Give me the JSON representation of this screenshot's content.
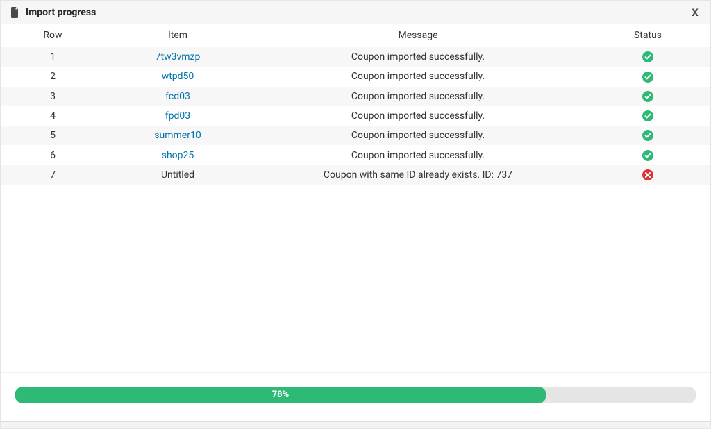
{
  "dialog": {
    "title": "Import progress",
    "close_label": "X"
  },
  "table": {
    "headers": {
      "row": "Row",
      "item": "Item",
      "message": "Message",
      "status": "Status"
    },
    "rows": [
      {
        "row": "1",
        "item": "7tw3vmzp",
        "item_is_link": true,
        "message": "Coupon imported successfully.",
        "status": "success"
      },
      {
        "row": "2",
        "item": "wtpd50",
        "item_is_link": true,
        "message": "Coupon imported successfully.",
        "status": "success"
      },
      {
        "row": "3",
        "item": "fcd03",
        "item_is_link": true,
        "message": "Coupon imported successfully.",
        "status": "success"
      },
      {
        "row": "4",
        "item": "fpd03",
        "item_is_link": true,
        "message": "Coupon imported successfully.",
        "status": "success"
      },
      {
        "row": "5",
        "item": "summer10",
        "item_is_link": true,
        "message": "Coupon imported successfully.",
        "status": "success"
      },
      {
        "row": "6",
        "item": "shop25",
        "item_is_link": true,
        "message": "Coupon imported successfully.",
        "status": "success"
      },
      {
        "row": "7",
        "item": "Untitled",
        "item_is_link": false,
        "message": "Coupon with same ID already exists. ID: 737",
        "status": "error"
      }
    ]
  },
  "progress": {
    "percent": 78,
    "label": "78%"
  },
  "colors": {
    "link": "#0073aa",
    "success": "#2fb977",
    "error": "#d63638",
    "progress_bg": "#e5e5e5"
  }
}
